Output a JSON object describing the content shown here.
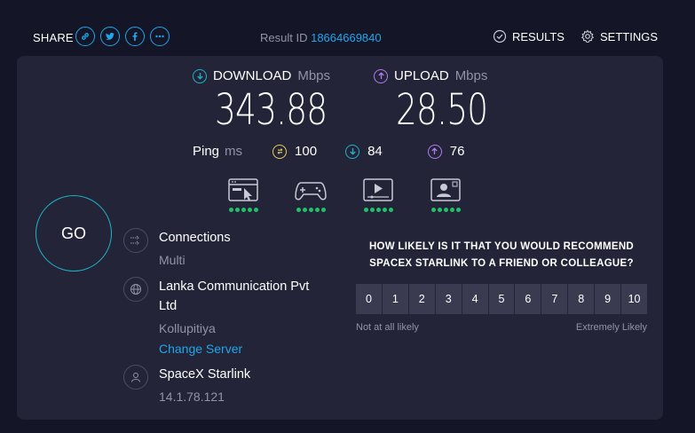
{
  "header": {
    "share_label": "SHARE",
    "share_icons": [
      "link-icon",
      "twitter-icon",
      "facebook-icon",
      "more-icon"
    ],
    "result_id_label": "Result ID",
    "result_id_value": "18664669840",
    "results_label": "RESULTS",
    "settings_label": "SETTINGS"
  },
  "download": {
    "label": "DOWNLOAD",
    "unit": "Mbps",
    "value": "343.88",
    "color": "#1fb3c8"
  },
  "upload": {
    "label": "UPLOAD",
    "unit": "Mbps",
    "value": "28.50",
    "color": "#b07cf0"
  },
  "ping": {
    "label": "Ping",
    "unit": "ms",
    "idle": "100",
    "download": "84",
    "upload": "76",
    "idle_color": "#e6d05a"
  },
  "performance_icons": [
    "web-browsing-icon",
    "gaming-icon",
    "video-streaming-icon",
    "video-chat-icon"
  ],
  "performance_rating": [
    5,
    5,
    5,
    5
  ],
  "go_label": "GO",
  "connections": {
    "title": "Connections",
    "value": "Multi"
  },
  "isp": {
    "name": "Lanka Communication Pvt Ltd",
    "location": "Kollupitiya",
    "change_label": "Change Server"
  },
  "user": {
    "provider": "SpaceX Starlink",
    "ip": "14.1.78.121"
  },
  "survey": {
    "question": "HOW LIKELY IS IT THAT YOU WOULD RECOMMEND SPACEX STARLINK TO A FRIEND OR COLLEAGUE?",
    "options": [
      "0",
      "1",
      "2",
      "3",
      "4",
      "5",
      "6",
      "7",
      "8",
      "9",
      "10"
    ],
    "low_label": "Not at all likely",
    "high_label": "Extremely Likely"
  },
  "colors": {
    "accent": "#1fa6ec",
    "rating_dot": "#21c16a",
    "background": "#141526",
    "card": "#232437"
  }
}
